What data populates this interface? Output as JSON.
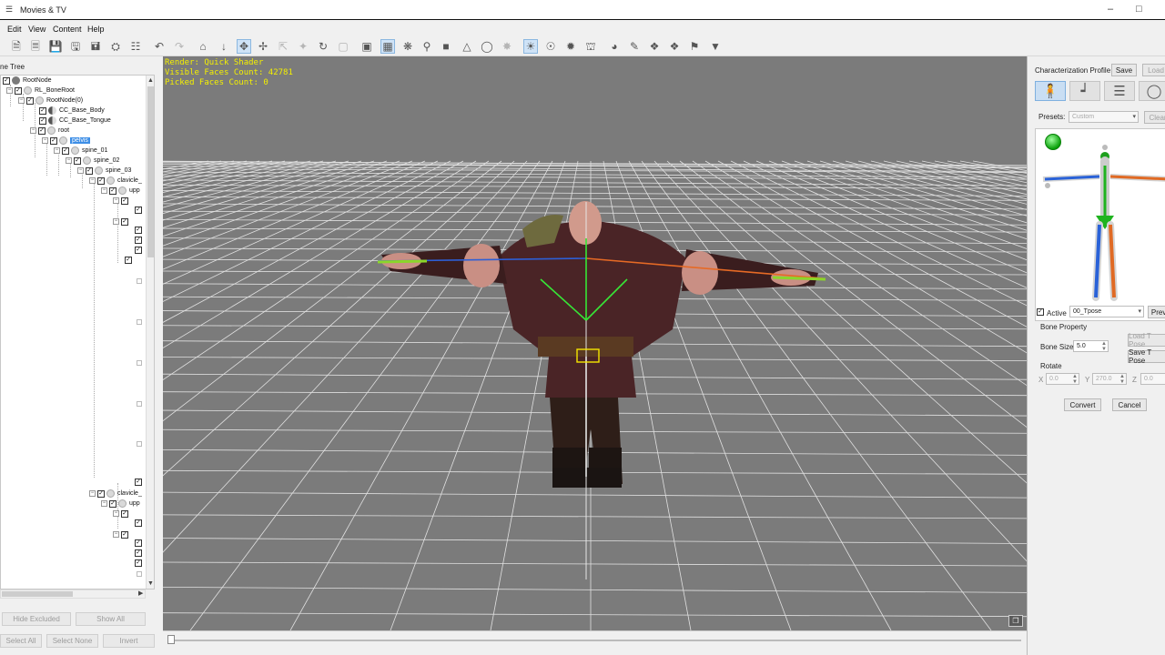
{
  "window": {
    "title": "Movies & TV",
    "minimize": "–",
    "maximize": "□"
  },
  "menu": [
    "Edit",
    "View",
    "Content",
    "Help"
  ],
  "toolbar_icons": [
    "new-icon",
    "open-icon",
    "save-icon",
    "save-as-icon",
    "export-icon",
    "import-icon",
    "merge-icon",
    "undo-icon",
    "redo-icon",
    "home-icon",
    "arrow-down-icon",
    "move-icon",
    "rotate-icon",
    "scale-icon",
    "transform-icon",
    "reset-icon",
    "select-icon",
    "grid-icon",
    "gizmo-icon",
    "pin-icon",
    "box-icon",
    "floor-icon",
    "globe-icon",
    "spot-icon",
    "light-icon",
    "sun-icon",
    "point-light-icon",
    "building-icon",
    "sphere-icon",
    "brush-icon",
    "clone-icon",
    "group-icon",
    "tag-icon",
    "cart-icon"
  ],
  "bone_tree": {
    "title": "ne Tree",
    "nodes": [
      {
        "label": "RootNode"
      },
      {
        "label": "RL_BoneRoot"
      },
      {
        "label": "RootNode(0)"
      },
      {
        "label": "CC_Base_Body"
      },
      {
        "label": "CC_Base_Tongue"
      },
      {
        "label": "root"
      },
      {
        "label": "pelvis"
      },
      {
        "label": "spine_01"
      },
      {
        "label": "spine_02"
      },
      {
        "label": "spine_03"
      },
      {
        "label": "clavicle_"
      },
      {
        "label": "upp"
      },
      {
        "label": "clavicle_"
      },
      {
        "label": "upp"
      }
    ],
    "buttons": {
      "hide_excluded": "Hide Excluded",
      "show_all": "Show All",
      "select_all": "Select All",
      "select_none": "Select None",
      "invert": "Invert"
    }
  },
  "viewport": {
    "render": "Render: Quick Shader",
    "visible_faces": "Visible Faces Count: 42781",
    "picked_faces": "Picked Faces Count: 0"
  },
  "characterization": {
    "title": "Characterization Profile",
    "save": "Save",
    "load": "Load",
    "presets_label": "Presets:",
    "presets_value": "Custom",
    "clear": "Clear",
    "active_label": "Active",
    "active_checked": true,
    "pose_value": "00_Tpose",
    "preview": "Previ",
    "bone_property": "Bone Property",
    "bone_size_label": "Bone Size",
    "bone_size_value": "5.0",
    "load_tpose": "Load T Pose",
    "save_tpose": "Save T Pose",
    "rotate_label": "Rotate",
    "x_label": "X",
    "x_value": "0.0",
    "y_label": "Y",
    "y_value": "270.0",
    "z_label": "Z",
    "z_value": "0.0",
    "convert": "Convert",
    "cancel": "Cancel"
  },
  "colors": {
    "viewport_bg": "#7b7b7b",
    "grid": "#ededed",
    "hud_text": "#f4f000",
    "selection": "#3d8ee6"
  }
}
